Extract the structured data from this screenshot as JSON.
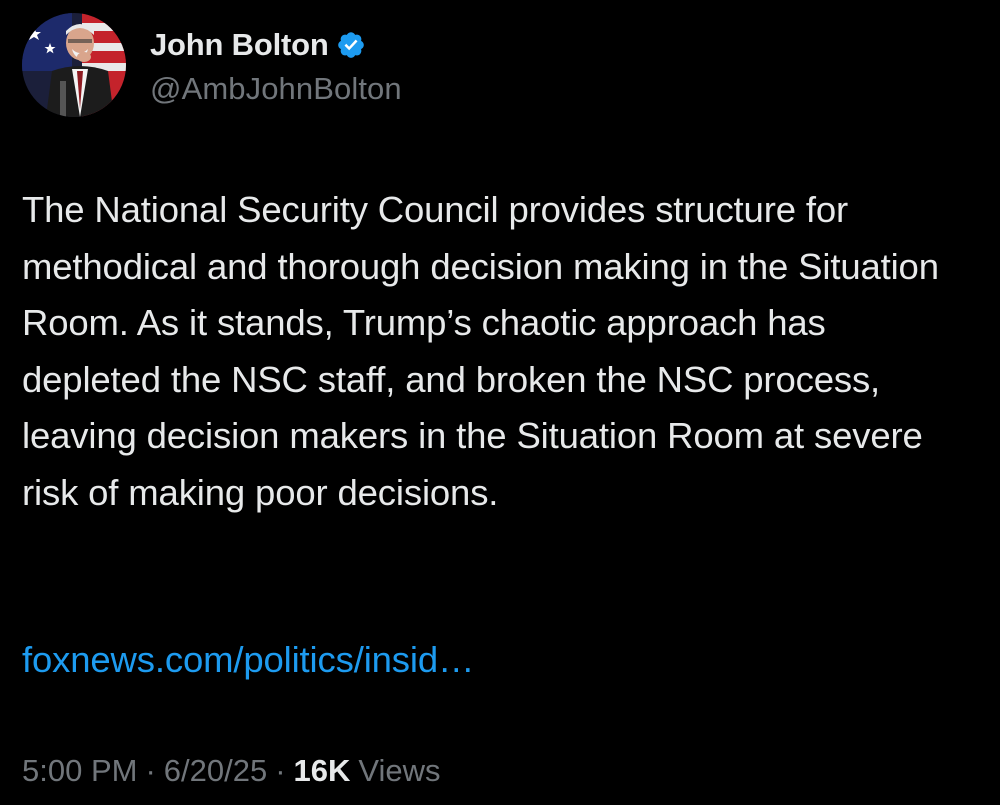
{
  "author": {
    "display_name": "John Bolton",
    "handle": "@AmbJohnBolton",
    "verified": true,
    "verified_color": "#1d9bf0"
  },
  "post": {
    "text": "The National Security Council provides structure for methodical and thorough decision making in the Situation Room. As it stands, Trump’s chaotic approach has depleted the NSC staff, and broken the NSC process, leaving decision makers in the Situation Room at severe risk of making poor decisions.",
    "link_text": "foxnews.com/politics/insid…",
    "link_color": "#1d9bf0"
  },
  "meta": {
    "time": "5:00 PM",
    "separator": "·",
    "date": "6/20/25",
    "views_count": "16K",
    "views_label": "Views"
  },
  "icons": {
    "verified": "verified-badge-icon"
  },
  "colors": {
    "background": "#000000",
    "text_primary": "#e7e9ea",
    "text_secondary": "#71767b"
  }
}
